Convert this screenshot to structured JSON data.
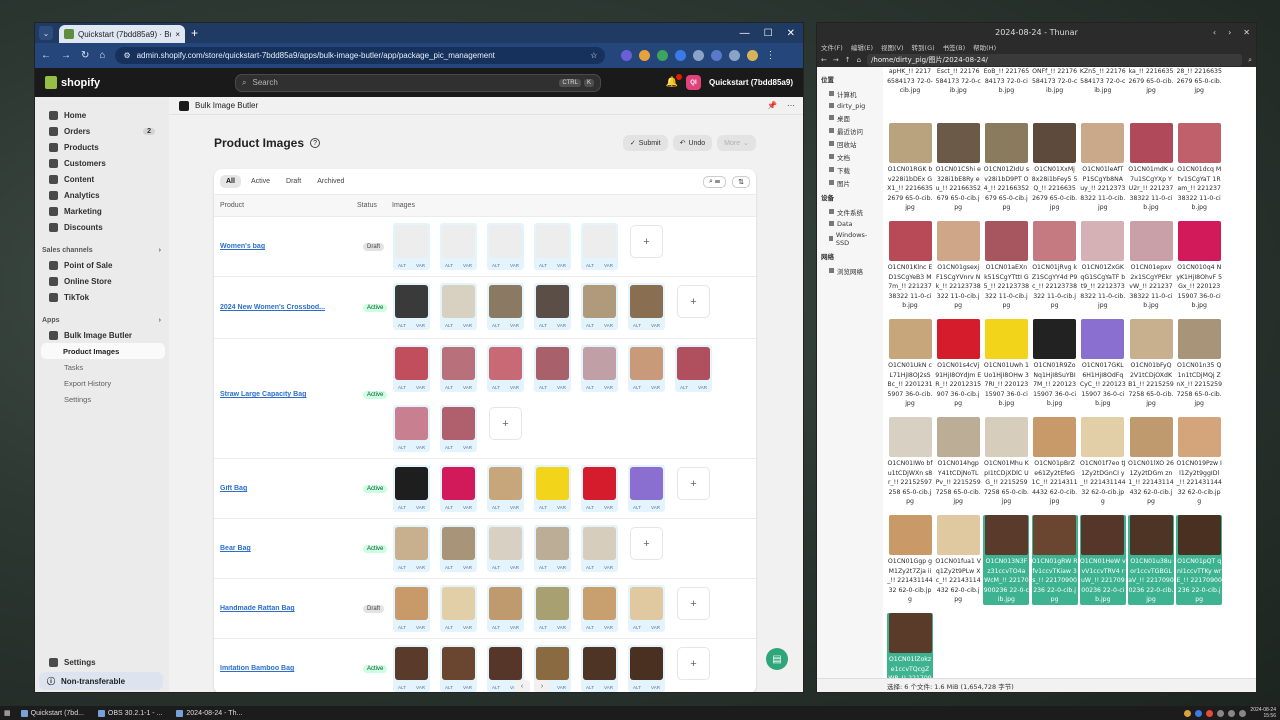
{
  "browser": {
    "tab_title": "Quickstart (7bdd85a9) · Bul",
    "url": "admin.shopify.com/store/quickstart-7bdd85a9/apps/bulk-image-butler/app/package_pic_management"
  },
  "shopify": {
    "logo": "shopify",
    "search_placeholder": "Search",
    "kbd1": "CTRL",
    "kbd2": "K",
    "store_name": "Quickstart (7bdd85a9)",
    "avatar": "QI"
  },
  "sidebar": {
    "main": [
      {
        "label": "Home"
      },
      {
        "label": "Orders",
        "count": "2"
      },
      {
        "label": "Products"
      },
      {
        "label": "Customers"
      },
      {
        "label": "Content"
      },
      {
        "label": "Analytics"
      },
      {
        "label": "Marketing"
      },
      {
        "label": "Discounts"
      }
    ],
    "sales_title": "Sales channels",
    "sales": [
      {
        "label": "Point of Sale"
      },
      {
        "label": "Online Store"
      },
      {
        "label": "TikTok"
      }
    ],
    "apps_title": "Apps",
    "app_name": "Bulk Image Butler",
    "app_sub": [
      "Product Images",
      "Tasks",
      "Export History",
      "Settings"
    ],
    "settings": "Settings",
    "non_transferable": "Non-transferable"
  },
  "app": {
    "header": "Bulk Image Butler",
    "title": "Product Images",
    "submit": "Submit",
    "undo": "Undo",
    "more": "More",
    "tabs": [
      "All",
      "Active",
      "Draft",
      "Archived"
    ],
    "col_product": "Product",
    "col_status": "Status",
    "col_images": "Images",
    "tag_alt": "ALT",
    "tag_var": "VAR",
    "products": [
      {
        "name": "Women's bag",
        "status": "Draft"
      },
      {
        "name": "2024 New Women's Crossbod...",
        "status": "Active"
      },
      {
        "name": "Straw Large Capacity Bag",
        "status": "Active"
      },
      {
        "name": "Gift Bag",
        "status": "Active"
      },
      {
        "name": "Bear Bag",
        "status": "Active"
      },
      {
        "name": "Handmade Rattan Bag",
        "status": "Draft"
      },
      {
        "name": "Imitation Bamboo Bag",
        "status": "Active"
      }
    ]
  },
  "filemanager": {
    "title": "2024-08-24 - Thunar",
    "menu": [
      "文件(F)",
      "编辑(E)",
      "视图(V)",
      "转到(G)",
      "书签(B)",
      "帮助(H)"
    ],
    "path": "/home/dirty_pig/图片/2024-08-24/",
    "side_places": "位置",
    "side_items": [
      "计算机",
      "dirty_pig",
      "桌面",
      "最近访问",
      "回收站",
      "文档",
      "下载",
      "图片"
    ],
    "side_devices": "设备",
    "device_items": [
      "文件系统",
      "Data",
      "Windows-SSD"
    ],
    "side_network": "网络",
    "network_items": [
      "浏览网络"
    ],
    "status": "选择: 6 个文件: 1.6 MiB (1,654,728 字节)",
    "files": [
      {
        "name": "apHK_!! 22176584173 72-0-cib.jpg",
        "color": "#ffffff"
      },
      {
        "name": "Esct_!! 22176584173 72-0-cib.jpg",
        "color": "#ffffff"
      },
      {
        "name": "EoB_!! 22176584173 72-0-cib.jpg",
        "color": "#ffffff"
      },
      {
        "name": "ONFf_!! 22176584173 72-0-cib.jpg",
        "color": "#ffffff"
      },
      {
        "name": "KZn5_!! 22176584173 72-0-cib.jpg",
        "color": "#ffffff"
      },
      {
        "name": "ka_!! 22166352679 65-0-cib.jpg",
        "color": "#ffffff"
      },
      {
        "name": "28_!! 22166352679 65-0-cib.jpg",
        "color": "#ffffff"
      },
      {
        "name": "O1CN01RGK bv228i1bDEx GX1_!! 22166352679 65-0-cib.jpg",
        "color": "#b9a27e"
      },
      {
        "name": "O1CN01CShi e328i1bE8Ry eu_!! 22166352679 65-0-cib.jpg",
        "color": "#6b5a48"
      },
      {
        "name": "O1CN01ZIdU sv28i1bD9PT O4_!! 22166352679 65-0-cib.jpg",
        "color": "#8a7a5e"
      },
      {
        "name": "O1CN01XxMj 8x28i1bFey5 5Q_!! 22166352679 65-0-cib.jpg",
        "color": "#5d4a3c"
      },
      {
        "name": "O1CN01leAfT P1SCgYb8NA uy_!! 22123738322 11-0-cib.jpg",
        "color": "#c9a98a"
      },
      {
        "name": "O1CN01mdK u7u1SCgYXp YU2r_!! 22123738322 11-0-cib.jpg",
        "color": "#b04a5a"
      },
      {
        "name": "O1CN01dcq Mtv1SCgYaT 1Ram_!! 22123738322 11-0-cib.jpg",
        "color": "#c0606b"
      },
      {
        "name": "O1CN01Klnc ED1SCgYeB3 M7m_!! 22123738322 11-0-cib.jpg",
        "color": "#b84a58"
      },
      {
        "name": "O1CN01gsexj F1SCgYVnrv Nk_!! 22123738322 11-0-cib.jpg",
        "color": "#cfa688"
      },
      {
        "name": "O1CN01aEXn k51SCgYTttI G5_!! 22123738322 11-0-cib.jpg",
        "color": "#a7555f"
      },
      {
        "name": "O1CN01jRvg kZ1SCgYY4d P9c_!! 22123738322 11-0-cib.jpg",
        "color": "#c47a80"
      },
      {
        "name": "O1CN01ZxGK qG1SCgYaTF bt9_!! 22123738322 11-0-cib.jpg",
        "color": "#d5b0b5"
      },
      {
        "name": "O1CN01epxv 2x1SCgYPEkr vW_!! 22123738322 11-0-cib.jpg",
        "color": "#c9a0a8"
      },
      {
        "name": "O1CN010q4 NyK1HjI8OhvF 5Gx_!! 22012315907 36-0-cib.jpg",
        "color": "#d21a5a"
      },
      {
        "name": "O1CN01UkN cL71HjI8OJ2sS Bc_!! 22012315907 36-0-cib.jpg",
        "color": "#c8a67c"
      },
      {
        "name": "O1CN01s4cVj 91HjI8OYdJm ER_!! 22012315907 36-0-cib.jpg",
        "color": "#d41c2c"
      },
      {
        "name": "O1CN01Uwh 1Uo1HjI8OHw 37RI_!! 22012315907 36-0-cib.jpg",
        "color": "#f2d51a"
      },
      {
        "name": "O1CN01R9Zo Nq1HjI8SuYBI 7M_!! 22012315907 36-0-cib.jpg",
        "color": "#222222"
      },
      {
        "name": "O1CN017GKL 6H1HjI8OdFq CyC_!! 22012315907 36-0-cib.jpg",
        "color": "#8a6fd0"
      },
      {
        "name": "O1CN01bFyQ 2V1tCDjOXdK B1_!! 22152597258 65-0-cib.jpg",
        "color": "#c8b08e"
      },
      {
        "name": "O1CN01n35 Q1n1tCDjMQj ZnX_!! 22152597258 65-0-cib.jpg",
        "color": "#a89478"
      },
      {
        "name": "O1CN01IWo bfu1tCDjWXn s8r_!! 22152597258 65-0-cib.jpg",
        "color": "#d8d0c2"
      },
      {
        "name": "O1CN014hgp Y41tCDjNoTL Pv_!! 22152597258 65-0-cib.jpg",
        "color": "#bcae96"
      },
      {
        "name": "O1CN01Mhu KpI1tCDjXDlC UG_!! 22152597258 65-0-cib.jpg",
        "color": "#d6cdbd"
      },
      {
        "name": "O1CN01pBrZ e61Zy2tEfeG 1C_!! 22143114432 62-0-cib.jpg",
        "color": "#c89a6a"
      },
      {
        "name": "O1CN01f7eo tJ1Zy2tDGnCI y_!! 22143114432 62-0-cib.jpg",
        "color": "#e2cfa8"
      },
      {
        "name": "O1CN01lXO 261Zy2tDGm zn1_!! 22143114432 62-0-cib.jpg",
        "color": "#bf9a6e"
      },
      {
        "name": "O1CN019Pzw Il1Zy2t9ggIDl _!! 22143114432 62-0-cib.jpg",
        "color": "#d4a57a"
      },
      {
        "name": "O1CN01Ggp gM1Zy2t7Zja ii_!! 22143114432 62-0-cib.jpg",
        "color": "#c99a68"
      },
      {
        "name": "O1CN01fua1 Vq1Zy2t9PLw Xc_!! 22143114432 62-0-cib.jpg",
        "color": "#e0c9a0"
      },
      {
        "name": "O1CN013N3F z31ccvTO4a WcM_!! 22170900236 22-0-cib.jpg",
        "color": "#5a3a2a",
        "selected": true
      },
      {
        "name": "O1CN01gRW Rfv1ccvTKiaw 3s_!! 22170900236 22-0-cib.jpg",
        "color": "#6a4630",
        "selected": true
      },
      {
        "name": "O1CN01HeW vvV1ccvTRV4 ruW_!! 22170900236 22-0-cib.jpg",
        "color": "#553628",
        "selected": true
      },
      {
        "name": "O1CN01u38u or1ccvTGBGL aV_!! 22170900236 22-0-cib.jpg",
        "color": "#4e3424",
        "selected": true
      },
      {
        "name": "O1CN01pQT qnI1ccvTTKy wrE_!! 22170900236 22-0-cib.jpg",
        "color": "#4a3020",
        "selected": true
      },
      {
        "name": "O1CN01lZokz e1ccvTQcgZ WP_!! 22170900236 22-0-cib.jpg",
        "color": "#5a3a28",
        "selected": true
      }
    ]
  },
  "taskbar": {
    "items": [
      "Quickstart (7bd...",
      "OBS 30.2.1-1 - ...",
      "2024-08-24 - Th..."
    ],
    "date": "2024-08-24",
    "time": "15:56"
  }
}
